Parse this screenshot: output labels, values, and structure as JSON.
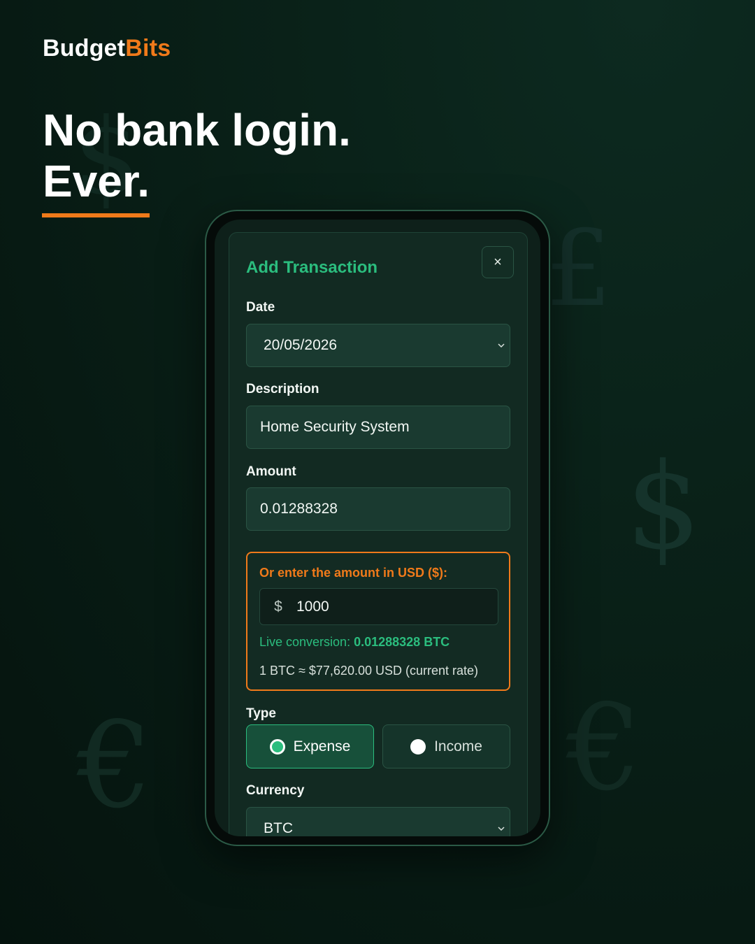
{
  "brand": {
    "part1": "Budget",
    "part2": "Bits"
  },
  "headline": {
    "line1": "No bank login.",
    "line2": "Ever."
  },
  "modal": {
    "title": "Add Transaction",
    "close_icon": "×",
    "date": {
      "label": "Date",
      "value": "20/05/2026"
    },
    "description": {
      "label": "Description",
      "value": "Home Security System"
    },
    "amount": {
      "label": "Amount",
      "value": "0.01288328"
    },
    "usd": {
      "label": "Or enter the amount in USD ($):",
      "prefix": "$",
      "value": "1000",
      "conversion_label": "Live conversion:",
      "conversion_value": "0.01288328 BTC",
      "rate": "1 BTC ≈ $77,620.00 USD (current rate)"
    },
    "type": {
      "label": "Type",
      "options": [
        "Expense",
        "Income"
      ],
      "selected": "Expense"
    },
    "currency": {
      "label": "Currency",
      "value": "BTC"
    }
  },
  "colors": {
    "accent_green": "#2bbd7e",
    "accent_orange": "#f07a1a",
    "background": "#0a2219"
  },
  "background_symbols": [
    "$",
    "£",
    "$",
    "€",
    "€"
  ]
}
